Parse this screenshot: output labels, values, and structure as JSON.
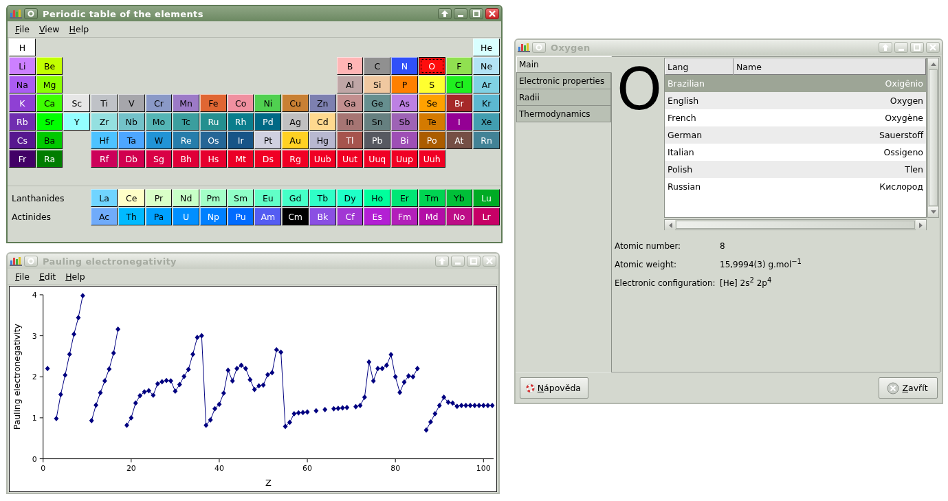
{
  "periodic_window": {
    "title": "Periodic table of the elements",
    "active": true,
    "menu": [
      "File",
      "View",
      "Help"
    ],
    "table": {
      "rows": [
        [
          {
            "kind": "element",
            "symbol": "H",
            "color": "#ffffff",
            "selected": false
          },
          {
            "kind": "empty"
          },
          {
            "kind": "empty"
          },
          {
            "kind": "empty"
          },
          {
            "kind": "empty"
          },
          {
            "kind": "empty"
          },
          {
            "kind": "empty"
          },
          {
            "kind": "empty"
          },
          {
            "kind": "empty"
          },
          {
            "kind": "empty"
          },
          {
            "kind": "empty"
          },
          {
            "kind": "empty"
          },
          {
            "kind": "empty"
          },
          {
            "kind": "empty"
          },
          {
            "kind": "empty"
          },
          {
            "kind": "empty"
          },
          {
            "kind": "empty"
          },
          {
            "kind": "element",
            "symbol": "He",
            "color": "#d9ffff",
            "selected": false
          }
        ],
        [
          {
            "kind": "element",
            "symbol": "Li",
            "color": "#cc80ff",
            "selected": false
          },
          {
            "kind": "element",
            "symbol": "Be",
            "color": "#c2ff00",
            "selected": false
          },
          {
            "kind": "empty"
          },
          {
            "kind": "empty"
          },
          {
            "kind": "empty"
          },
          {
            "kind": "empty"
          },
          {
            "kind": "empty"
          },
          {
            "kind": "empty"
          },
          {
            "kind": "empty"
          },
          {
            "kind": "empty"
          },
          {
            "kind": "empty"
          },
          {
            "kind": "empty"
          },
          {
            "kind": "element",
            "symbol": "B",
            "color": "#ffb5b5",
            "selected": false
          },
          {
            "kind": "element",
            "symbol": "C",
            "color": "#909090",
            "selected": false
          },
          {
            "kind": "element",
            "symbol": "N",
            "color": "#3050f8",
            "selected": false
          },
          {
            "kind": "element",
            "symbol": "O",
            "color": "#ff0d0d",
            "selected": true
          },
          {
            "kind": "element",
            "symbol": "F",
            "color": "#90e050",
            "selected": false
          },
          {
            "kind": "element",
            "symbol": "Ne",
            "color": "#b3e3f5",
            "selected": false
          }
        ],
        [
          {
            "kind": "element",
            "symbol": "Na",
            "color": "#ab5cf2",
            "selected": false
          },
          {
            "kind": "element",
            "symbol": "Mg",
            "color": "#8aff00",
            "selected": false
          },
          {
            "kind": "empty"
          },
          {
            "kind": "empty"
          },
          {
            "kind": "empty"
          },
          {
            "kind": "empty"
          },
          {
            "kind": "empty"
          },
          {
            "kind": "empty"
          },
          {
            "kind": "empty"
          },
          {
            "kind": "empty"
          },
          {
            "kind": "empty"
          },
          {
            "kind": "empty"
          },
          {
            "kind": "element",
            "symbol": "Al",
            "color": "#bfa6a6",
            "selected": false
          },
          {
            "kind": "element",
            "symbol": "Si",
            "color": "#f0c8a0",
            "selected": false
          },
          {
            "kind": "element",
            "symbol": "P",
            "color": "#ff8000",
            "selected": false
          },
          {
            "kind": "element",
            "symbol": "S",
            "color": "#ffff30",
            "selected": false
          },
          {
            "kind": "element",
            "symbol": "Cl",
            "color": "#1ff01f",
            "selected": false
          },
          {
            "kind": "element",
            "symbol": "Ar",
            "color": "#80d1e3",
            "selected": false
          }
        ],
        [
          {
            "kind": "element",
            "symbol": "K",
            "color": "#8f40d4",
            "selected": false
          },
          {
            "kind": "element",
            "symbol": "Ca",
            "color": "#3dff00",
            "selected": false
          },
          {
            "kind": "element",
            "symbol": "Sc",
            "color": "#e6e6e6",
            "selected": false
          },
          {
            "kind": "element",
            "symbol": "Ti",
            "color": "#bfc2c7",
            "selected": false
          },
          {
            "kind": "element",
            "symbol": "V",
            "color": "#a6a6ab",
            "selected": false
          },
          {
            "kind": "element",
            "symbol": "Cr",
            "color": "#8a99c7",
            "selected": false
          },
          {
            "kind": "element",
            "symbol": "Mn",
            "color": "#9c7ac7",
            "selected": false
          },
          {
            "kind": "element",
            "symbol": "Fe",
            "color": "#e06633",
            "selected": false
          },
          {
            "kind": "element",
            "symbol": "Co",
            "color": "#f090a0",
            "selected": false
          },
          {
            "kind": "element",
            "symbol": "Ni",
            "color": "#50d050",
            "selected": false
          },
          {
            "kind": "element",
            "symbol": "Cu",
            "color": "#c88033",
            "selected": false
          },
          {
            "kind": "element",
            "symbol": "Zn",
            "color": "#7d80b0",
            "selected": false
          },
          {
            "kind": "element",
            "symbol": "Ga",
            "color": "#c28f8f",
            "selected": false
          },
          {
            "kind": "element",
            "symbol": "Ge",
            "color": "#668f8f",
            "selected": false
          },
          {
            "kind": "element",
            "symbol": "As",
            "color": "#bd80e3",
            "selected": false
          },
          {
            "kind": "element",
            "symbol": "Se",
            "color": "#ffa100",
            "selected": false
          },
          {
            "kind": "element",
            "symbol": "Br",
            "color": "#a62929",
            "selected": false
          },
          {
            "kind": "element",
            "symbol": "Kr",
            "color": "#5cb8d1",
            "selected": false
          }
        ],
        [
          {
            "kind": "element",
            "symbol": "Rb",
            "color": "#702eb0",
            "selected": false
          },
          {
            "kind": "element",
            "symbol": "Sr",
            "color": "#00ff00",
            "selected": false
          },
          {
            "kind": "element",
            "symbol": "Y",
            "color": "#94ffff",
            "selected": false
          },
          {
            "kind": "element",
            "symbol": "Zr",
            "color": "#94e0e0",
            "selected": false
          },
          {
            "kind": "element",
            "symbol": "Nb",
            "color": "#73c2c9",
            "selected": false
          },
          {
            "kind": "element",
            "symbol": "Mo",
            "color": "#54b5b5",
            "selected": false
          },
          {
            "kind": "element",
            "symbol": "Tc",
            "color": "#3b9e9e",
            "selected": false
          },
          {
            "kind": "element",
            "symbol": "Ru",
            "color": "#248f8f",
            "selected": false
          },
          {
            "kind": "element",
            "symbol": "Rh",
            "color": "#0a7d8c",
            "selected": false
          },
          {
            "kind": "element",
            "symbol": "Pd",
            "color": "#006985",
            "selected": false
          },
          {
            "kind": "element",
            "symbol": "Ag",
            "color": "#c0c0c0",
            "selected": false
          },
          {
            "kind": "element",
            "symbol": "Cd",
            "color": "#ffd98f",
            "selected": false
          },
          {
            "kind": "element",
            "symbol": "In",
            "color": "#a67573",
            "selected": false
          },
          {
            "kind": "element",
            "symbol": "Sn",
            "color": "#668080",
            "selected": false
          },
          {
            "kind": "element",
            "symbol": "Sb",
            "color": "#9e63b5",
            "selected": false
          },
          {
            "kind": "element",
            "symbol": "Te",
            "color": "#d47a00",
            "selected": false
          },
          {
            "kind": "element",
            "symbol": "I",
            "color": "#940094",
            "selected": false
          },
          {
            "kind": "element",
            "symbol": "Xe",
            "color": "#429eb0",
            "selected": false
          }
        ],
        [
          {
            "kind": "element",
            "symbol": "Cs",
            "color": "#57178f",
            "selected": false
          },
          {
            "kind": "element",
            "symbol": "Ba",
            "color": "#00c900",
            "selected": false
          },
          {
            "kind": "empty"
          },
          {
            "kind": "element",
            "symbol": "Hf",
            "color": "#4dc2ff",
            "selected": false
          },
          {
            "kind": "element",
            "symbol": "Ta",
            "color": "#4da6ff",
            "selected": false
          },
          {
            "kind": "element",
            "symbol": "W",
            "color": "#2194d6",
            "selected": false
          },
          {
            "kind": "element",
            "symbol": "Re",
            "color": "#267dab",
            "selected": false
          },
          {
            "kind": "element",
            "symbol": "Os",
            "color": "#266696",
            "selected": false
          },
          {
            "kind": "element",
            "symbol": "Ir",
            "color": "#175487",
            "selected": false
          },
          {
            "kind": "element",
            "symbol": "Pt",
            "color": "#d0d0e0",
            "selected": false
          },
          {
            "kind": "element",
            "symbol": "Au",
            "color": "#ffd123",
            "selected": false
          },
          {
            "kind": "element",
            "symbol": "Hg",
            "color": "#b8b8d0",
            "selected": false
          },
          {
            "kind": "element",
            "symbol": "Tl",
            "color": "#a6544d",
            "selected": false
          },
          {
            "kind": "element",
            "symbol": "Pb",
            "color": "#575961",
            "selected": false
          },
          {
            "kind": "element",
            "symbol": "Bi",
            "color": "#9e4fb5",
            "selected": false
          },
          {
            "kind": "element",
            "symbol": "Po",
            "color": "#ab5c00",
            "selected": false
          },
          {
            "kind": "element",
            "symbol": "At",
            "color": "#754f45",
            "selected": false
          },
          {
            "kind": "element",
            "symbol": "Rn",
            "color": "#428296",
            "selected": false
          }
        ],
        [
          {
            "kind": "element",
            "symbol": "Fr",
            "color": "#420066",
            "selected": false
          },
          {
            "kind": "element",
            "symbol": "Ra",
            "color": "#007d00",
            "selected": false
          },
          {
            "kind": "empty"
          },
          {
            "kind": "element",
            "symbol": "Rf",
            "color": "#cc0059",
            "selected": false
          },
          {
            "kind": "element",
            "symbol": "Db",
            "color": "#d1004f",
            "selected": false
          },
          {
            "kind": "element",
            "symbol": "Sg",
            "color": "#d90045",
            "selected": false
          },
          {
            "kind": "element",
            "symbol": "Bh",
            "color": "#e00038",
            "selected": false
          },
          {
            "kind": "element",
            "symbol": "Hs",
            "color": "#e6002e",
            "selected": false
          },
          {
            "kind": "element",
            "symbol": "Mt",
            "color": "#eb0026",
            "selected": false
          },
          {
            "kind": "element",
            "symbol": "Ds",
            "color": "#f00024",
            "selected": false
          },
          {
            "kind": "element",
            "symbol": "Rg",
            "color": "#f00024",
            "selected": false
          },
          {
            "kind": "element",
            "symbol": "Uub",
            "color": "#f00024",
            "selected": false
          },
          {
            "kind": "element",
            "symbol": "Uut",
            "color": "#f00024",
            "selected": false
          },
          {
            "kind": "element",
            "symbol": "Uuq",
            "color": "#f00024",
            "selected": false
          },
          {
            "kind": "element",
            "symbol": "Uup",
            "color": "#f00024",
            "selected": false
          },
          {
            "kind": "element",
            "symbol": "Uuh",
            "color": "#f00024",
            "selected": false
          },
          {
            "kind": "empty"
          },
          {
            "kind": "empty"
          }
        ]
      ]
    },
    "series_rows": [
      {
        "label": "Lanthanides",
        "elements": [
          {
            "symbol": "La",
            "color": "#70d4ff",
            "selected": false
          },
          {
            "symbol": "Ce",
            "color": "#ffffc7",
            "selected": false
          },
          {
            "symbol": "Pr",
            "color": "#d9ffc7",
            "selected": false
          },
          {
            "symbol": "Nd",
            "color": "#c7ffc7",
            "selected": false
          },
          {
            "symbol": "Pm",
            "color": "#a3ffc7",
            "selected": false
          },
          {
            "symbol": "Sm",
            "color": "#8fffc7",
            "selected": false
          },
          {
            "symbol": "Eu",
            "color": "#61ffc7",
            "selected": false
          },
          {
            "symbol": "Gd",
            "color": "#45ffc7",
            "selected": false
          },
          {
            "symbol": "Tb",
            "color": "#30ffc7",
            "selected": false
          },
          {
            "symbol": "Dy",
            "color": "#1fffc7",
            "selected": false
          },
          {
            "symbol": "Ho",
            "color": "#00ff9c",
            "selected": false
          },
          {
            "symbol": "Er",
            "color": "#00e675",
            "selected": false
          },
          {
            "symbol": "Tm",
            "color": "#00d452",
            "selected": false
          },
          {
            "symbol": "Yb",
            "color": "#00bf38",
            "selected": false
          },
          {
            "symbol": "Lu",
            "color": "#00ab24",
            "selected": false
          }
        ]
      },
      {
        "label": "Actinides",
        "elements": [
          {
            "symbol": "Ac",
            "color": "#70abfa",
            "selected": false
          },
          {
            "symbol": "Th",
            "color": "#00baff",
            "selected": false
          },
          {
            "symbol": "Pa",
            "color": "#00a1ff",
            "selected": false
          },
          {
            "symbol": "U",
            "color": "#008fff",
            "selected": false
          },
          {
            "symbol": "Np",
            "color": "#0080ff",
            "selected": false
          },
          {
            "symbol": "Pu",
            "color": "#006bff",
            "selected": false
          },
          {
            "symbol": "Am",
            "color": "#545cf2",
            "selected": false
          },
          {
            "symbol": "Cm",
            "color": "#000000",
            "selected": false
          },
          {
            "symbol": "Bk",
            "color": "#8a4fe3",
            "selected": false
          },
          {
            "symbol": "Cf",
            "color": "#a136d4",
            "selected": false
          },
          {
            "symbol": "Es",
            "color": "#b31fd4",
            "selected": false
          },
          {
            "symbol": "Fm",
            "color": "#b31fba",
            "selected": false
          },
          {
            "symbol": "Md",
            "color": "#b30da6",
            "selected": false
          },
          {
            "symbol": "No",
            "color": "#bd0d87",
            "selected": false
          },
          {
            "symbol": "Lr",
            "color": "#c70066",
            "selected": false
          }
        ]
      }
    ]
  },
  "chart_window": {
    "title": "Pauling electronegativity",
    "active": false,
    "menu": [
      "File",
      "Edit",
      "Help"
    ],
    "plot": {
      "chart_data": {
        "type": "line",
        "xlabel": "Z",
        "ylabel": "Pauling electronegativity",
        "xlim": [
          0,
          102.3
        ],
        "ylim": [
          0,
          4
        ],
        "xticks": [
          0,
          20,
          40,
          60,
          80,
          100
        ],
        "yticks": [
          0,
          1,
          2,
          3,
          4
        ],
        "x": [
          1,
          2,
          3,
          4,
          5,
          6,
          7,
          8,
          9,
          10,
          11,
          12,
          13,
          14,
          15,
          16,
          17,
          18,
          19,
          20,
          21,
          22,
          23,
          24,
          25,
          26,
          27,
          28,
          29,
          30,
          31,
          32,
          33,
          34,
          35,
          36,
          37,
          38,
          39,
          40,
          41,
          42,
          43,
          44,
          45,
          46,
          47,
          48,
          49,
          50,
          51,
          52,
          53,
          54,
          55,
          56,
          57,
          58,
          59,
          60,
          61,
          62,
          63,
          64,
          65,
          66,
          67,
          68,
          69,
          70,
          71,
          72,
          73,
          74,
          75,
          76,
          77,
          78,
          79,
          80,
          81,
          82,
          83,
          84,
          85,
          86,
          87,
          88,
          89,
          90,
          91,
          92,
          93,
          94,
          95,
          96,
          97,
          98,
          99,
          100,
          101,
          102
        ],
        "series": [
          {
            "color": "#000080",
            "marker": "diamond",
            "values": [
              2.2,
              null,
              0.98,
              1.57,
              2.04,
              2.55,
              3.04,
              3.44,
              3.98,
              null,
              0.93,
              1.31,
              1.61,
              1.9,
              2.19,
              2.58,
              3.16,
              null,
              0.82,
              1.0,
              1.36,
              1.54,
              1.63,
              1.66,
              1.55,
              1.83,
              1.88,
              1.91,
              1.9,
              1.65,
              1.81,
              2.01,
              2.18,
              2.55,
              2.96,
              3.0,
              0.82,
              0.95,
              1.22,
              1.33,
              1.6,
              2.16,
              1.9,
              2.2,
              2.28,
              2.2,
              1.93,
              1.69,
              1.78,
              1.8,
              2.05,
              2.1,
              2.66,
              2.6,
              0.79,
              0.89,
              1.1,
              1.12,
              1.13,
              1.14,
              null,
              1.17,
              null,
              1.2,
              null,
              1.22,
              1.23,
              1.24,
              1.25,
              null,
              1.27,
              1.3,
              1.5,
              2.36,
              1.9,
              2.2,
              2.2,
              2.28,
              2.54,
              2.0,
              1.62,
              1.87,
              2.02,
              2.0,
              2.2,
              null,
              0.7,
              0.9,
              1.1,
              1.3,
              1.5,
              1.38,
              1.36,
              1.28,
              1.3,
              1.3,
              1.3,
              1.3,
              1.3,
              1.3,
              1.3,
              1.3
            ]
          }
        ]
      }
    }
  },
  "oxygen_window": {
    "title": "Oxygen",
    "active": false,
    "tabs": [
      {
        "label": "Main",
        "selected": true
      },
      {
        "label": "Electronic properties",
        "selected": false
      },
      {
        "label": "Radii",
        "selected": false
      },
      {
        "label": "Thermodynamics",
        "selected": false
      }
    ],
    "symbol": "O",
    "names_table": {
      "columns": [
        "Lang",
        "Name"
      ],
      "rows": [
        {
          "lang": "Brazilian",
          "name": "Oxigênio",
          "selected": true
        },
        {
          "lang": "English",
          "name": "Oxygen",
          "selected": false
        },
        {
          "lang": "French",
          "name": "Oxygène",
          "selected": false
        },
        {
          "lang": "German",
          "name": "Sauerstoff",
          "selected": false
        },
        {
          "lang": "Italian",
          "name": "Ossigeno",
          "selected": false
        },
        {
          "lang": "Polish",
          "name": "Tlen",
          "selected": false
        },
        {
          "lang": "Russian",
          "name": "Кислород",
          "selected": false
        }
      ]
    },
    "properties": [
      {
        "label": "Atomic number:",
        "value": "8"
      },
      {
        "label": "Atomic weight:",
        "value": "15,9994(3) g.mol$^{−1}$"
      },
      {
        "label": "Electronic configuration:",
        "value": "[He] 2s$^{2}$ 2p$^{4}$"
      }
    ],
    "buttons": [
      {
        "kind": "help",
        "label": "Nápověda"
      },
      {
        "kind": "close",
        "label": "Zavřít"
      }
    ]
  }
}
